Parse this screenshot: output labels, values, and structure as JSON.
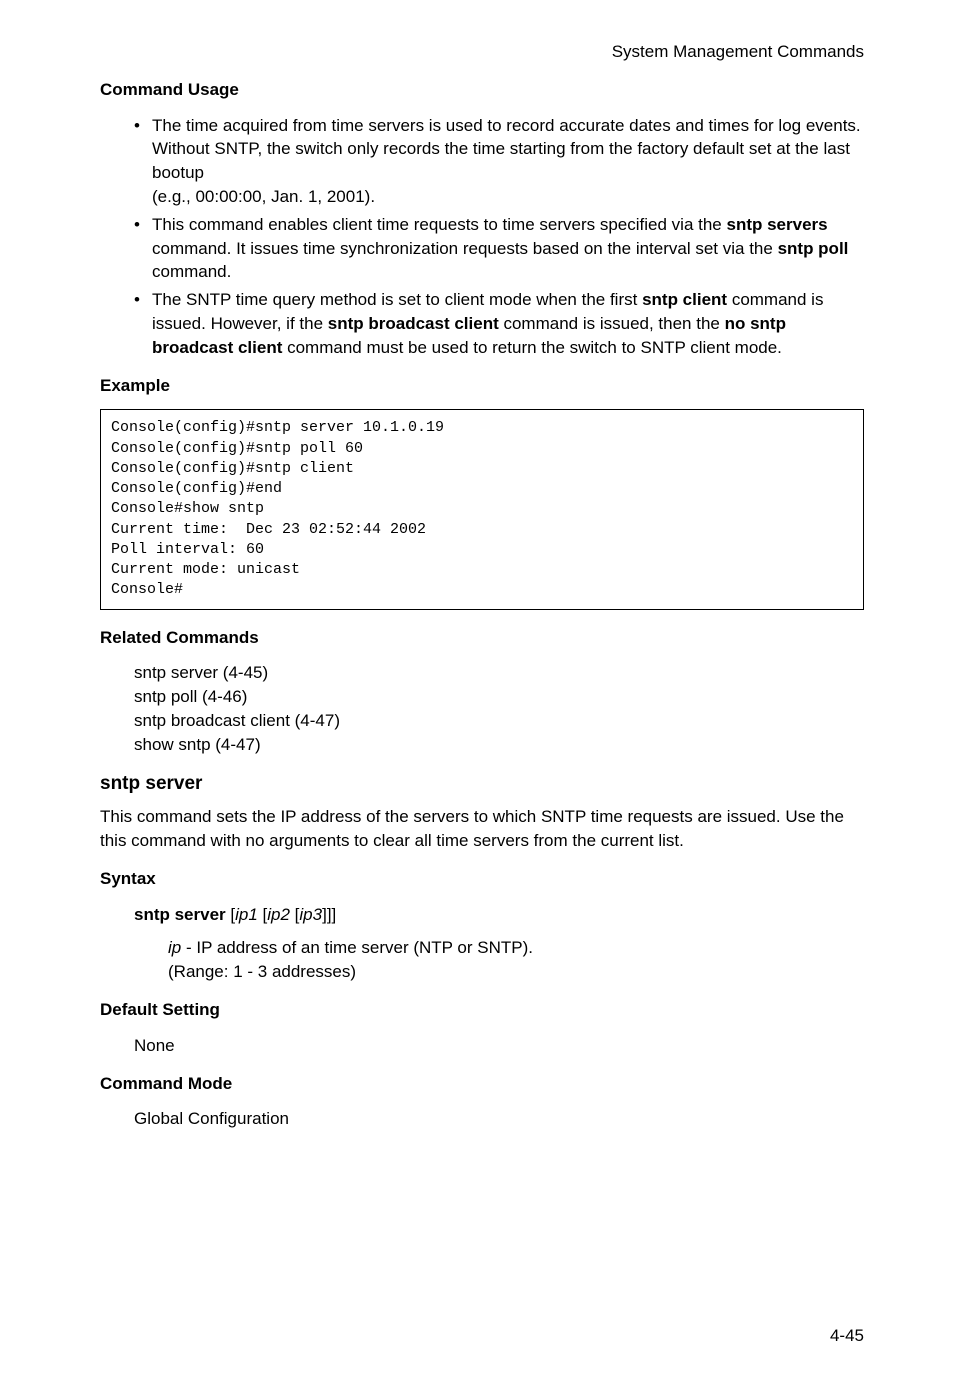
{
  "header": {
    "right": "System Management Commands"
  },
  "sections": {
    "commandUsage": {
      "title": "Command Usage",
      "bullets": [
        {
          "pre": "The time acquired from time servers is used to record accurate dates and times for log events. Without SNTP, the switch only records the time starting from the factory default set at the last bootup",
          "sub": "(e.g., 00:00:00, Jan. 1, 2001)."
        },
        {
          "segments": [
            "This command enables client time requests to time servers specified via the ",
            "sntp servers",
            " command. It issues time synchronization requests based on the ",
            "interval set via the ",
            "sntp poll",
            " command."
          ]
        },
        {
          "segments2": [
            "The SNTP time query method is set to client mode when the first ",
            "sntp client",
            " command is issued. However, if the ",
            "sntp broadcast client",
            " command is issued, then the ",
            "no sntp broadcast client",
            " command must be used to return the switch to SNTP client mode."
          ]
        }
      ]
    },
    "example": {
      "title": "Example",
      "code": "Console(config)#sntp server 10.1.0.19\nConsole(config)#sntp poll 60\nConsole(config)#sntp client\nConsole(config)#end\nConsole#show sntp\nCurrent time:  Dec 23 02:52:44 2002\nPoll interval: 60\nCurrent mode: unicast\nConsole#"
    },
    "related": {
      "title": "Related Commands",
      "lines": [
        "sntp server (4-45)",
        "sntp poll (4-46)",
        "sntp broadcast client (4-47)",
        "show sntp (4-47)"
      ]
    },
    "sntpServer": {
      "heading": "sntp server",
      "desc": "This command sets the IP address of the servers to which SNTP time requests are issued. Use the this command with no arguments to clear all time servers from the current list."
    },
    "syntax": {
      "title": "Syntax",
      "cmd": {
        "bold": "sntp server",
        "i1": "ip1",
        "i2": "ip2",
        "i3": "ip3",
        "brackets": [
          " [",
          " [",
          " [",
          "]]]"
        ]
      },
      "desc": {
        "iplabel": "ip",
        "text": " - IP address of an time server (NTP or SNTP).",
        "range": "(Range: 1 - 3 addresses)"
      }
    },
    "defaultSetting": {
      "title": "Default Setting",
      "value": "None"
    },
    "commandMode": {
      "title": "Command Mode",
      "value": "Global Configuration"
    }
  },
  "pageNumber": "4-45"
}
